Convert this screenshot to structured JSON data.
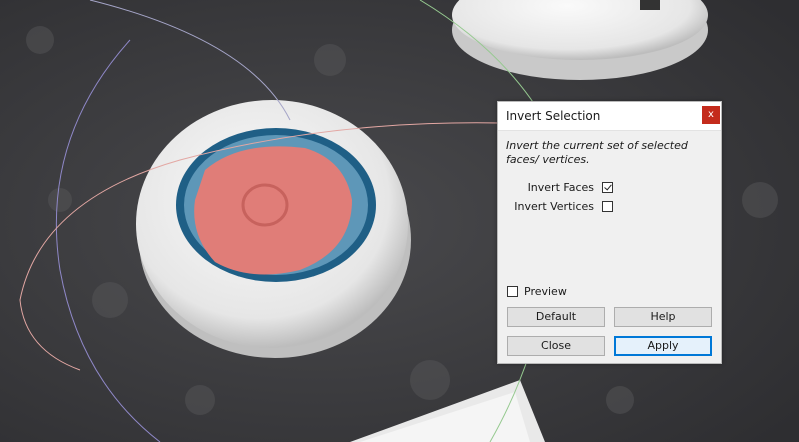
{
  "dialog": {
    "title": "Invert Selection",
    "close_label": "x",
    "description": "Invert the current set of selected faces/ vertices.",
    "invert_faces": {
      "label": "Invert Faces",
      "checked": true
    },
    "invert_vertices": {
      "label": "Invert Vertices",
      "checked": false
    },
    "preview": {
      "label": "Preview",
      "checked": false
    },
    "buttons": {
      "default": "Default",
      "help": "Help",
      "close": "Close",
      "apply": "Apply"
    }
  },
  "colors": {
    "selection": "#e07d78",
    "accent": "#0078d7",
    "close_button": "#c42b1c"
  }
}
